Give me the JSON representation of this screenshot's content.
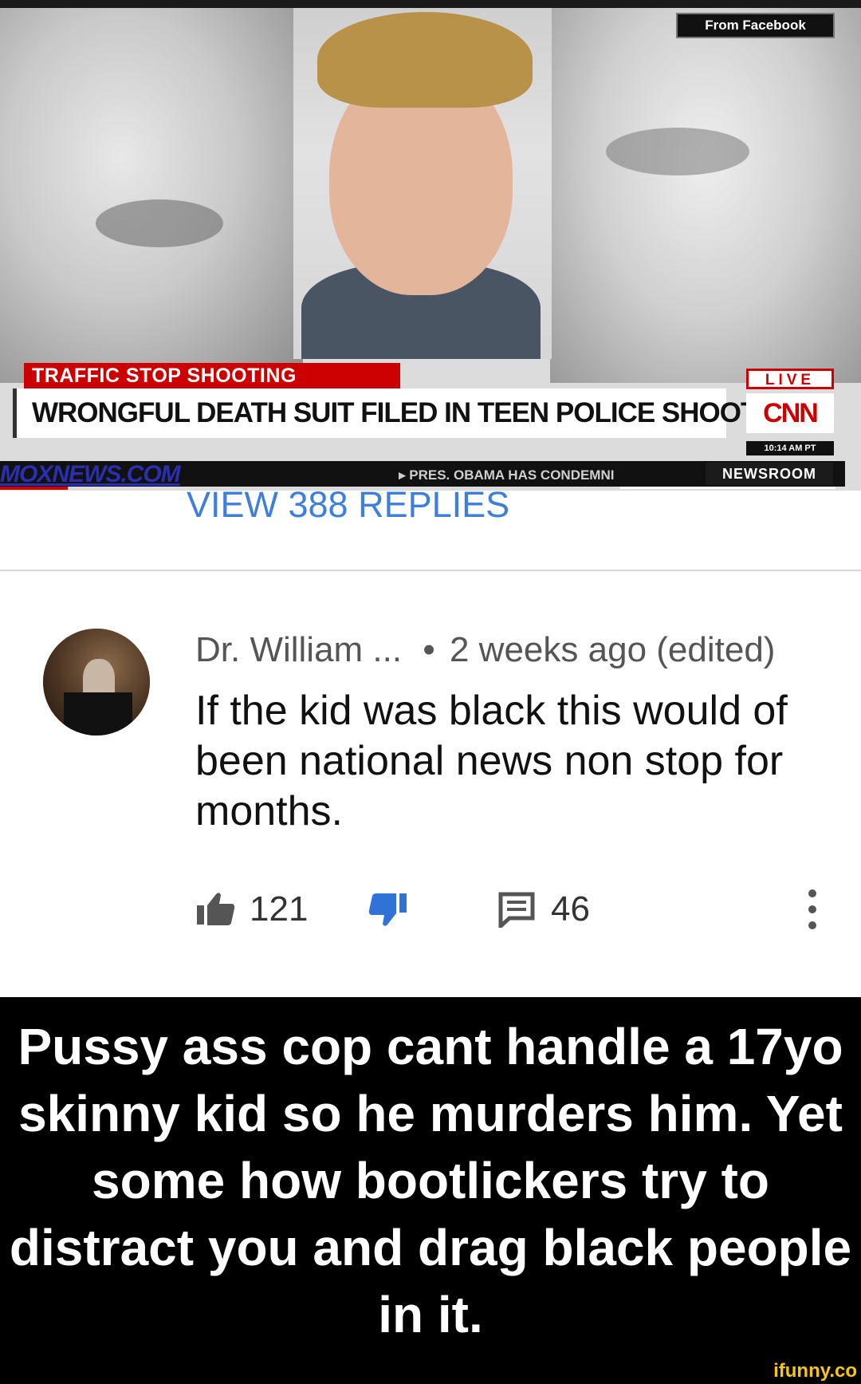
{
  "news": {
    "source_badge": "From Facebook",
    "kicker": "TRAFFIC STOP SHOOTING",
    "headline": "WRONGFUL DEATH SUIT FILED IN TEEN POLICE SHOOTING",
    "live": "LIVE",
    "network": "CNN",
    "time": "10:14 AM PT",
    "watermark": "MOXNEWS.COM",
    "ticker": "▸ PRES. OBAMA HAS CONDEMNI",
    "show": "NEWSROOM"
  },
  "replies": {
    "label": "VIEW 388 REPLIES"
  },
  "comment": {
    "author": "Dr. William ...",
    "separator": "•",
    "age": "2 weeks ago (edited)",
    "text": "If the kid was black this would of been national news non stop for months.",
    "likes": "121",
    "replies": "46",
    "accent": "#2f73d9"
  },
  "caption": {
    "text": "Pussy ass cop cant handle a 17yo skinny kid so he murders him. Yet some how bootlickers try to distract you and drag black people in it."
  },
  "watermark": "ifunny.co"
}
